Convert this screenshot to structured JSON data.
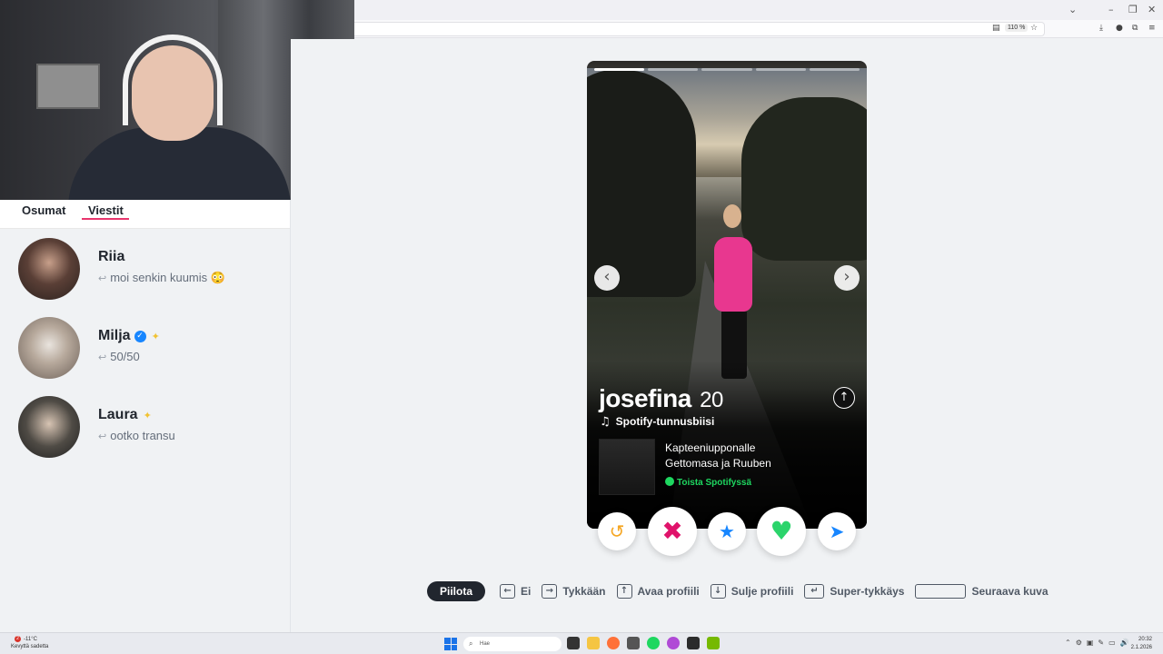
{
  "browser": {
    "zoom": "110 %",
    "controls": {
      "chevron": "⌄",
      "minimize": "–",
      "restore": "❐",
      "close": "✕"
    }
  },
  "sidebar": {
    "tabs": [
      {
        "label": "Osumat"
      },
      {
        "label": "Viestit"
      }
    ],
    "messages": [
      {
        "name": "Riia",
        "preview": "moi senkin kuumis 😳"
      },
      {
        "name": "Milja",
        "preview": "50/50"
      },
      {
        "name": "Laura",
        "preview": "ootko transu"
      }
    ]
  },
  "card": {
    "name": "josefina",
    "age": "20",
    "spotify_heading": "Spotify-tunnusbiisi",
    "song_line1": "Kapteeniupponalle",
    "song_line2": "Gettomasa ja Ruuben",
    "spotify_play": "Toista Spotifyssä",
    "photo_count": 5,
    "current_photo": 1
  },
  "shortcuts": {
    "hide": "Piilota",
    "no": "Ei",
    "like": "Tykkään",
    "open_profile": "Avaa profiili",
    "close_profile": "Sulje profiili",
    "super_like": "Super-tykkäys",
    "next_photo": "Seuraava kuva"
  },
  "taskbar": {
    "weather_temp": "-11°C",
    "weather_text": "Kevyttä sadetta",
    "search_placeholder": "Hae",
    "time": "20:32",
    "date": "2.1.2026",
    "notification_count": "2"
  },
  "colors": {
    "accent": "#e8356d",
    "nope": "#e0136b",
    "like": "#2bd46b",
    "super_like": "#1786ff",
    "rewind": "#f5a623",
    "boost": "#1786ff",
    "spotify": "#1ed760"
  }
}
